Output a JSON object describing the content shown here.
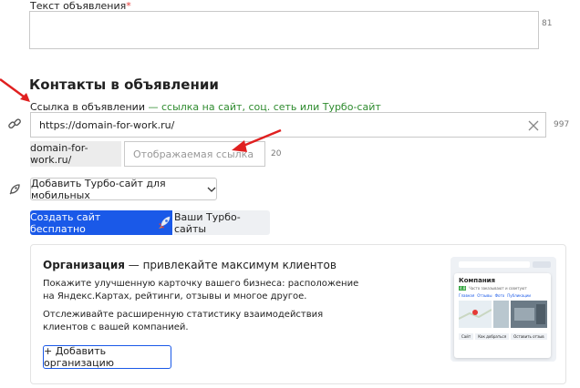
{
  "ad_text": {
    "label": "Текст объявления",
    "required_mark": "*",
    "counter": "81"
  },
  "contacts": {
    "heading": "Контакты в объявлении",
    "link_label": "Ссылка в объявлении",
    "link_hint": " — ссылка на сайт, соц. сеть или Турбо-сайт",
    "link_value": "https://domain-for-work.ru/",
    "link_counter": "997",
    "display_prefix": "domain-for-work.ru/",
    "display_placeholder": "Отображаемая ссылка",
    "display_counter": "20"
  },
  "turbo": {
    "dropdown_label": "Добавить Турбо-сайт для мобильных",
    "create_label": "Создать сайт бесплатно",
    "my_sites_label": "Ваши Турбо-сайты"
  },
  "organization": {
    "title": "Организация",
    "title_hint": " — привлекайте максимум клиентов",
    "para1": "Покажите улучшенную карточку вашего бизнеса: расположение на Яндекс.Картах, рейтинги, отзывы и многое другое.",
    "para2": "Отслеживайте расширенную статистику взаимодействия клиентов с вашей компанией.",
    "add_label": "+ Добавить организацию",
    "preview": {
      "company": "Компания",
      "rating": "4.8",
      "status": "Часто заказывают и советуют",
      "tabs": [
        "Главная",
        "Отзывы",
        "Фото",
        "Публикации"
      ],
      "actions": [
        "Сайт",
        "Как добраться",
        "Оставить отзыв"
      ]
    }
  },
  "colors": {
    "accent": "#1a59e8",
    "hint": "#2e8b2e",
    "annotation_arrow": "#e02020"
  }
}
